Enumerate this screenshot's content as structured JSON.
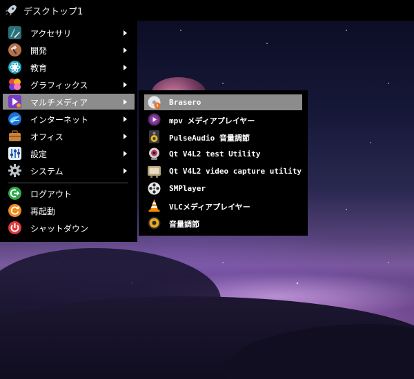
{
  "panel": {
    "title": "デスクトップ1"
  },
  "menu": {
    "items": [
      {
        "label": "アクセサリ",
        "icon": "accessories-icon"
      },
      {
        "label": "開発",
        "icon": "development-icon"
      },
      {
        "label": "教育",
        "icon": "education-icon"
      },
      {
        "label": "グラフィックス",
        "icon": "graphics-icon"
      },
      {
        "label": "マルチメディア",
        "icon": "multimedia-icon",
        "selected": true
      },
      {
        "label": "インターネット",
        "icon": "internet-icon"
      },
      {
        "label": "オフィス",
        "icon": "office-icon"
      },
      {
        "label": "設定",
        "icon": "settings-icon"
      },
      {
        "label": "システム",
        "icon": "system-gear-icon"
      }
    ],
    "session": [
      {
        "label": "ログアウト",
        "icon": "logout-icon"
      },
      {
        "label": "再起動",
        "icon": "reboot-icon"
      },
      {
        "label": "シャットダウン",
        "icon": "shutdown-icon"
      }
    ]
  },
  "submenu": {
    "items": [
      {
        "label": "Brasero",
        "icon": "brasero-disc-icon",
        "selected": true
      },
      {
        "label": "mpv メディアプレイヤー",
        "icon": "mpv-icon"
      },
      {
        "label": "PulseAudio 音量調節",
        "icon": "speaker-icon"
      },
      {
        "label": "Qt V4L2 test Utility",
        "icon": "webcam-icon"
      },
      {
        "label": "Qt V4L2 video capture utility",
        "icon": "tv-icon"
      },
      {
        "label": "SMPlayer",
        "icon": "film-reel-icon"
      },
      {
        "label": "VLCメディアプレイヤー",
        "icon": "vlc-cone-icon"
      },
      {
        "label": "音量調節",
        "icon": "volume-knob-icon"
      }
    ]
  },
  "colors": {
    "menu_bg": "#000000",
    "highlight": "#8c8c8c",
    "text": "#ffffff"
  }
}
